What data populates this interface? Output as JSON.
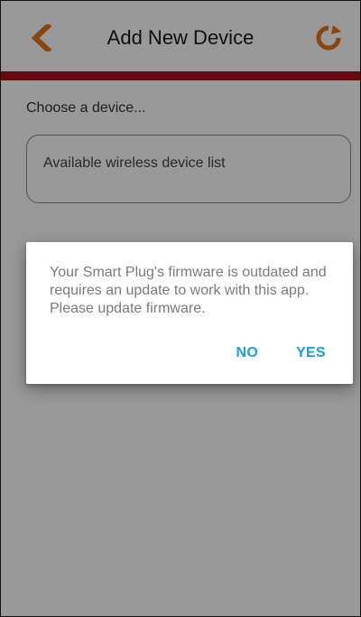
{
  "colors": {
    "accent": "#E8731A",
    "accent_bar": "#A8131B",
    "dialog_button": "#1E9FD1"
  },
  "header": {
    "title": "Add New Device",
    "back_icon": "chevron-left-icon",
    "refresh_icon": "refresh-icon"
  },
  "main": {
    "prompt": "Choose a device...",
    "device_list_placeholder": "Available wireless device list"
  },
  "dialog": {
    "message": "Your Smart Plug's firmware is outdated and requires an update to work with this app. Please update firmware.",
    "no_label": "NO",
    "yes_label": "YES"
  }
}
